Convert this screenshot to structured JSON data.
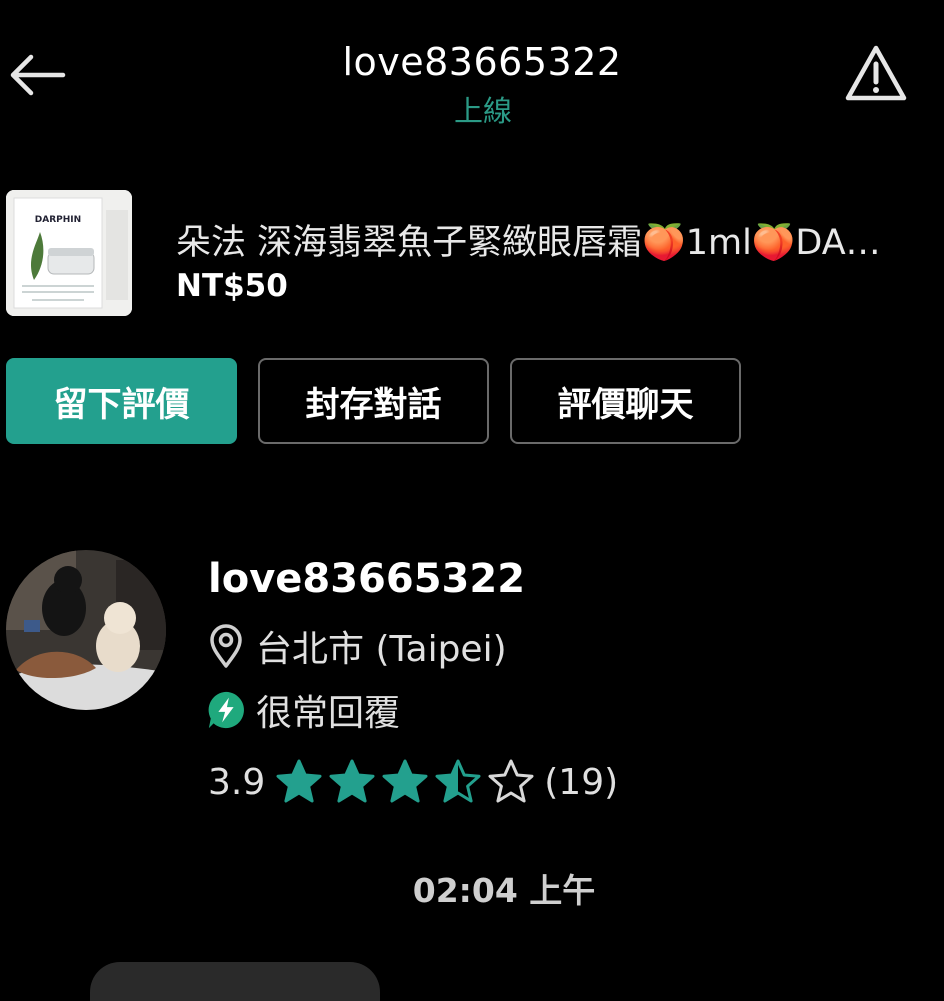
{
  "header": {
    "title": "love83665322",
    "status": "上線"
  },
  "product": {
    "thumb_brand": "DARPHIN",
    "title": "朵法 深海翡翠魚子緊緻眼唇霜🍑1ml🍑DA…",
    "price": "NT$50"
  },
  "actions": {
    "leave_review": "留下評價",
    "archive_chat": "封存對話",
    "review_chat": "評價聊天"
  },
  "seller": {
    "name": "love83665322",
    "location": "台北市 (Taipei)",
    "response": "很常回覆",
    "rating": "3.9",
    "rating_value": 3.5,
    "rating_max": 5,
    "review_count": "(19)"
  },
  "chat": {
    "timestamp": "02:04 上午"
  },
  "colors": {
    "accent": "#23a08e",
    "status_green": "#2b9a86",
    "background": "#000000"
  },
  "icons": {
    "back": "arrow-left-icon",
    "report": "warning-triangle-icon",
    "location": "location-pin-icon",
    "response": "lightning-bolt-icon",
    "star": "star-icon"
  }
}
